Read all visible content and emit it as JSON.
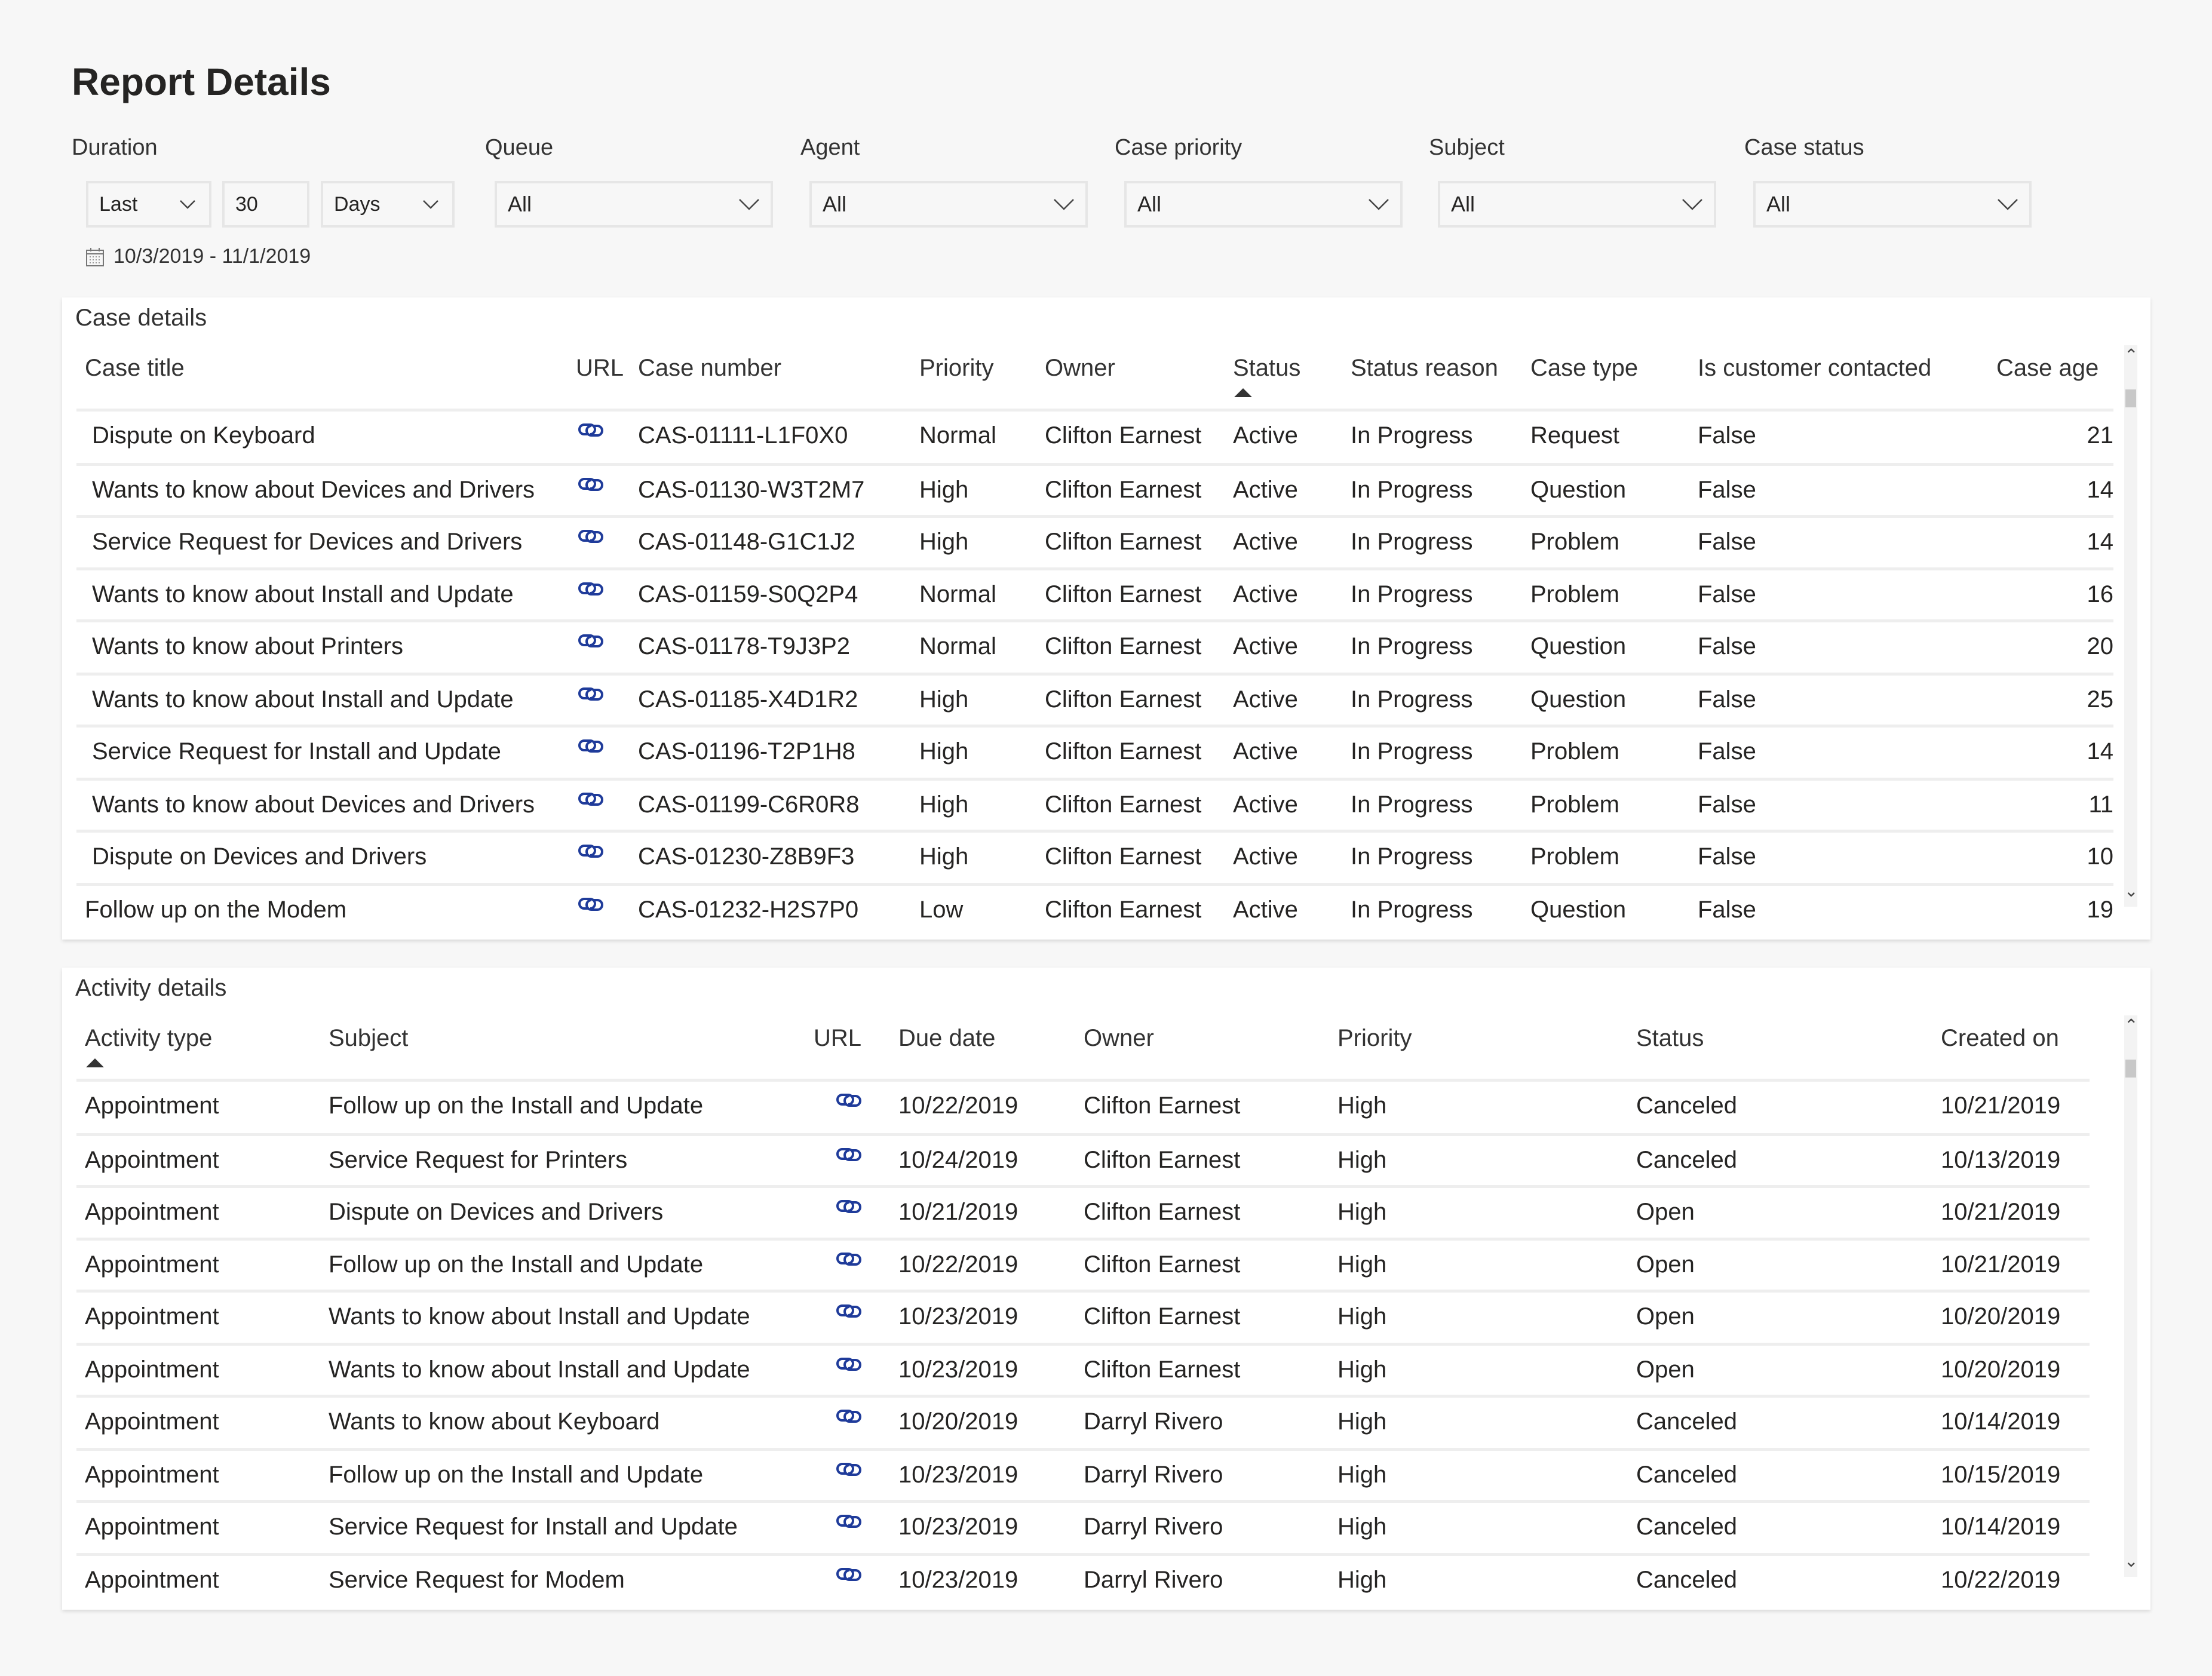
{
  "page": {
    "title": "Report Details"
  },
  "filters": {
    "duration": {
      "label": "Duration",
      "mode": "Last",
      "amount": "30",
      "unit": "Days",
      "date_range": "10/3/2019 - 11/1/2019"
    },
    "queue": {
      "label": "Queue",
      "value": "All"
    },
    "agent": {
      "label": "Agent",
      "value": "All"
    },
    "case_priority": {
      "label": "Case priority",
      "value": "All"
    },
    "subject": {
      "label": "Subject",
      "value": "All"
    },
    "case_status": {
      "label": "Case status",
      "value": "All"
    }
  },
  "case_details": {
    "title": "Case details",
    "sorted_by": "Status",
    "columns": [
      "Case title",
      "URL",
      "Case number",
      "Priority",
      "Owner",
      "Status",
      "Status reason",
      "Case type",
      "Is customer contacted",
      "Case age"
    ],
    "rows": [
      {
        "title": "Dispute on Keyboard",
        "number": "CAS-01111-L1F0X0",
        "priority": "Normal",
        "owner": "Clifton Earnest",
        "status": "Active",
        "reason": "In Progress",
        "type": "Request",
        "contacted": "False",
        "age": "21"
      },
      {
        "title": "Wants to know about Devices and Drivers",
        "number": "CAS-01130-W3T2M7",
        "priority": "High",
        "owner": "Clifton Earnest",
        "status": "Active",
        "reason": "In Progress",
        "type": "Question",
        "contacted": "False",
        "age": "14"
      },
      {
        "title": "Service Request for Devices and Drivers",
        "number": "CAS-01148-G1C1J2",
        "priority": "High",
        "owner": "Clifton Earnest",
        "status": "Active",
        "reason": "In Progress",
        "type": "Problem",
        "contacted": "False",
        "age": "14"
      },
      {
        "title": "Wants to know about Install and Update",
        "number": "CAS-01159-S0Q2P4",
        "priority": "Normal",
        "owner": "Clifton Earnest",
        "status": "Active",
        "reason": "In Progress",
        "type": "Problem",
        "contacted": "False",
        "age": "16"
      },
      {
        "title": "Wants to know about Printers",
        "number": "CAS-01178-T9J3P2",
        "priority": "Normal",
        "owner": "Clifton Earnest",
        "status": "Active",
        "reason": "In Progress",
        "type": "Question",
        "contacted": "False",
        "age": "20"
      },
      {
        "title": "Wants to know about Install and Update",
        "number": "CAS-01185-X4D1R2",
        "priority": "High",
        "owner": "Clifton Earnest",
        "status": "Active",
        "reason": "In Progress",
        "type": "Question",
        "contacted": "False",
        "age": "25"
      },
      {
        "title": "Service Request for Install and Update",
        "number": "CAS-01196-T2P1H8",
        "priority": "High",
        "owner": "Clifton Earnest",
        "status": "Active",
        "reason": "In Progress",
        "type": "Problem",
        "contacted": "False",
        "age": "14"
      },
      {
        "title": "Wants to know about Devices and Drivers",
        "number": "CAS-01199-C6R0R8",
        "priority": "High",
        "owner": "Clifton Earnest",
        "status": "Active",
        "reason": "In Progress",
        "type": "Problem",
        "contacted": "False",
        "age": "11"
      },
      {
        "title": "Dispute on Devices and Drivers",
        "number": "CAS-01230-Z8B9F3",
        "priority": "High",
        "owner": "Clifton Earnest",
        "status": "Active",
        "reason": "In Progress",
        "type": "Problem",
        "contacted": "False",
        "age": "10"
      },
      {
        "title": "Follow up on the  Modem",
        "number": "CAS-01232-H2S7P0",
        "priority": "Low",
        "owner": "Clifton Earnest",
        "status": "Active",
        "reason": "In Progress",
        "type": "Question",
        "contacted": "False",
        "age": "19"
      }
    ]
  },
  "activity_details": {
    "title": "Activity details",
    "sorted_by": "Activity type",
    "columns": [
      "Activity type",
      "Subject",
      "URL",
      "Due date",
      "Owner",
      "Priority",
      "Status",
      "Created on"
    ],
    "rows": [
      {
        "type": "Appointment",
        "subject": "Follow up on the Install and Update",
        "due": "10/22/2019",
        "owner": "Clifton Earnest",
        "priority": "High",
        "status": "Canceled",
        "created": "10/21/2019"
      },
      {
        "type": "Appointment",
        "subject": "Service Request for Printers",
        "due": "10/24/2019",
        "owner": "Clifton Earnest",
        "priority": "High",
        "status": "Canceled",
        "created": "10/13/2019"
      },
      {
        "type": "Appointment",
        "subject": "Dispute on Devices and Drivers",
        "due": "10/21/2019",
        "owner": "Clifton Earnest",
        "priority": "High",
        "status": "Open",
        "created": "10/21/2019"
      },
      {
        "type": "Appointment",
        "subject": "Follow up on the Install and Update",
        "due": "10/22/2019",
        "owner": "Clifton Earnest",
        "priority": "High",
        "status": "Open",
        "created": "10/21/2019"
      },
      {
        "type": "Appointment",
        "subject": "Wants to know about Install and Update",
        "due": "10/23/2019",
        "owner": "Clifton Earnest",
        "priority": "High",
        "status": "Open",
        "created": "10/20/2019"
      },
      {
        "type": "Appointment",
        "subject": "Wants to know about Install and Update",
        "due": "10/23/2019",
        "owner": "Clifton Earnest",
        "priority": "High",
        "status": "Open",
        "created": "10/20/2019"
      },
      {
        "type": "Appointment",
        "subject": "Wants to know about Keyboard",
        "due": "10/20/2019",
        "owner": "Darryl Rivero",
        "priority": "High",
        "status": "Canceled",
        "created": "10/14/2019"
      },
      {
        "type": "Appointment",
        "subject": "Follow up on the Install and Update",
        "due": "10/23/2019",
        "owner": "Darryl Rivero",
        "priority": "High",
        "status": "Canceled",
        "created": "10/15/2019"
      },
      {
        "type": "Appointment",
        "subject": "Service Request for Install and Update",
        "due": "10/23/2019",
        "owner": "Darryl Rivero",
        "priority": "High",
        "status": "Canceled",
        "created": "10/14/2019"
      },
      {
        "type": "Appointment",
        "subject": "Service Request for Modem",
        "due": "10/23/2019",
        "owner": "Darryl Rivero",
        "priority": "High",
        "status": "Canceled",
        "created": "10/22/2019"
      }
    ]
  },
  "colors": {
    "link": "#1f3b9a",
    "background": "#f7f7f7",
    "panel": "#ffffff",
    "divider": "#eeeeee"
  }
}
